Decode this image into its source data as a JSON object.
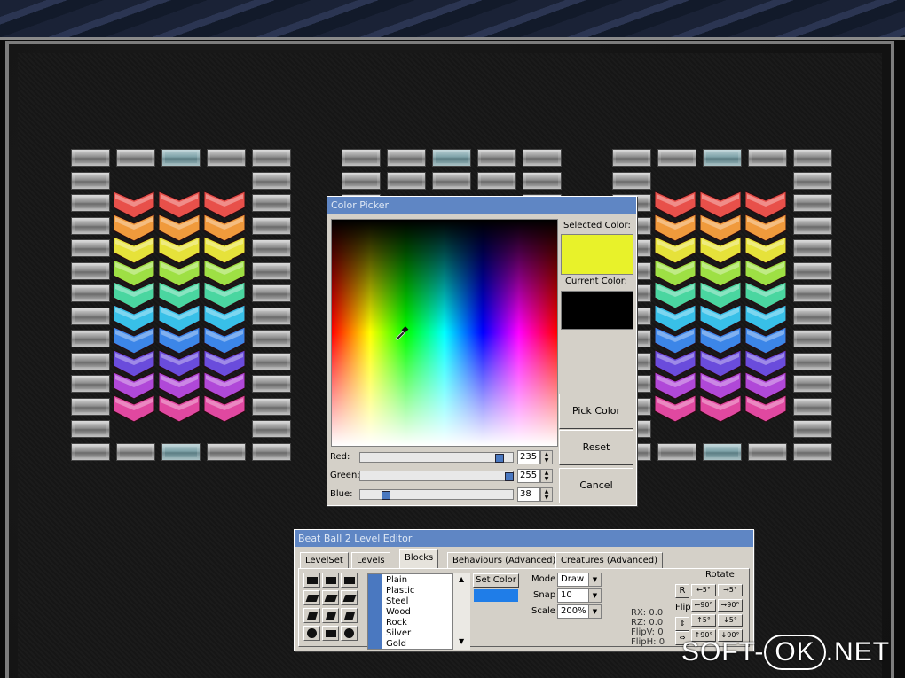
{
  "picker": {
    "title": "Color Picker",
    "selected_label": "Selected Color:",
    "current_label": "Current Color:",
    "selected_color": "#e8f22a",
    "current_color": "#000000",
    "pick_label": "Pick Color",
    "reset_label": "Reset",
    "cancel_label": "Cancel",
    "red_label": "Red:",
    "green_label": "Green:",
    "blue_label": "Blue:",
    "red_value": "235",
    "green_value": "255",
    "blue_value": "38"
  },
  "editor": {
    "title": "Beat Ball 2 Level Editor",
    "tabs": [
      "LevelSet",
      "Levels",
      "Blocks",
      "Behaviours (Advanced)",
      "Creatures (Advanced)"
    ],
    "active_tab": "Blocks",
    "materials": [
      "Plain",
      "Plastic",
      "Steel",
      "Wood",
      "Rock",
      "Silver",
      "Gold"
    ],
    "set_color_label": "Set Color",
    "set_color_value": "#1f7de8",
    "mode_label": "Mode",
    "mode_value": "Draw",
    "snap_label": "Snap",
    "snap_value": "10",
    "scale_label": "Scale",
    "scale_value": "200%",
    "rotate_label": "Rotate",
    "flip_label": "Flip",
    "r_label": "R",
    "rx": "RX: 0.0",
    "rz": "RZ: 0.0",
    "flipv": "FlipV: 0",
    "fliph": "FlipH: 0",
    "rot_buttons": [
      "←5°",
      "→5°",
      "←90°",
      "→90°",
      "↑5°",
      "↓5°",
      "↑90°",
      "↓90°"
    ]
  },
  "watermark": {
    "left": "SOFT-",
    "pill": "OK",
    "right": ".NET"
  },
  "colors": {
    "titlebar": "#5f86c4",
    "accent": "#4a78c0"
  }
}
